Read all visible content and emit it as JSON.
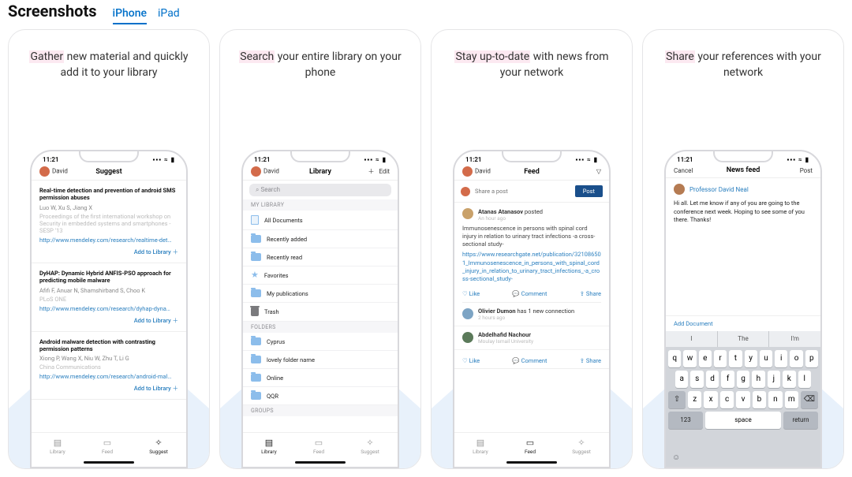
{
  "header": {
    "title": "Screenshots"
  },
  "tabs": [
    {
      "label": "iPhone",
      "active": true
    },
    {
      "label": "iPad",
      "active": false
    }
  ],
  "statusbar": {
    "time": "11:21",
    "right": "▪▪▪ ≈ ▮"
  },
  "captions": [
    {
      "hl": "Gather",
      "rest": " new material and quickly add it to your library"
    },
    {
      "hl": "Search",
      "rest": " your entire library on your phone"
    },
    {
      "hl": "Stay up-to-date",
      "rest": " with news from your network"
    },
    {
      "hl": "Share",
      "rest": " your references with your network"
    }
  ],
  "tabbar": [
    {
      "icon": "▤",
      "label": "Library"
    },
    {
      "icon": "▭",
      "label": "Feed"
    },
    {
      "icon": "✧",
      "label": "Suggest"
    }
  ],
  "card1": {
    "user": "David",
    "title": "Suggest",
    "items": [
      {
        "title": "Real-time detection and prevention of android SMS permission abuses",
        "authors": "Luo W, Xu S, Jiang X",
        "meta": "Proceedings of the first international workshop on Security in embedded systems and smartphones - SESP '13",
        "link": "http://www.mendeley.com/research/realtime-det…",
        "add": "Add to Library ＋"
      },
      {
        "title": "DyHAP: Dynamic Hybrid ANFIS-PSO approach for predicting mobile malware",
        "authors": "Afifi F, Anuar N, Shamshirband S, Choo K",
        "meta": "PLoS ONE",
        "link": "http://www.mendeley.com/research/dyhap-dyna…",
        "add": "Add to Library ＋"
      },
      {
        "title": "Android malware detection with contrasting permission patterns",
        "authors": "Xiong P, Wang X, Niu W, Zhu T, Li G",
        "meta": "China Communications",
        "link": "http://www.mendeley.com/research/android-mal…",
        "add": "Add to Library ＋"
      }
    ]
  },
  "card2": {
    "user": "David",
    "title": "Library",
    "add": "＋",
    "edit": "Edit",
    "search_placeholder": "⌕ Search",
    "sections": {
      "mylib": "MY LIBRARY",
      "folders": "FOLDERS",
      "groups": "GROUPS"
    },
    "mylib_items": [
      {
        "kind": "doc",
        "label": "All Documents"
      },
      {
        "kind": "folder",
        "label": "Recently added"
      },
      {
        "kind": "folder",
        "label": "Recently read"
      },
      {
        "kind": "star",
        "label": "Favorites"
      },
      {
        "kind": "folder",
        "label": "My publications"
      },
      {
        "kind": "trash",
        "label": "Trash"
      }
    ],
    "folders_items": [
      {
        "label": "Cyprus"
      },
      {
        "label": "lovely folder name"
      },
      {
        "label": "Online"
      },
      {
        "label": "QQR"
      }
    ]
  },
  "card3": {
    "user": "David",
    "title": "Feed",
    "share_placeholder": "Share a post",
    "post_btn": "Post",
    "feed": {
      "name": "Atanas Atanasov",
      "verb": "posted",
      "time": "An hour ago",
      "body": "Immunosenescence in persons with spinal cord injury in relation to urinary tract infections -a cross-sectional study-",
      "link": "https://www.researchgate.net/publication/321086501_Immunosenescence_in_persons_with_spinal_cord_injury_in_relation_to_urinary_tract_infections_-a_cross-sectional_study-"
    },
    "actions": {
      "like": "♡ Like",
      "comment": "💬 Comment",
      "share": "⇪ Share"
    },
    "sub1": {
      "name": "Olivier Dumon",
      "verb": "has 1 new connection",
      "time": "2 hours ago"
    },
    "sub2": {
      "name": "Abdelhafid Nachour",
      "meta": "Moulay Ismail University"
    }
  },
  "card4": {
    "cancel": "Cancel",
    "title": "News feed",
    "post": "Post",
    "author": "Professor David Neal",
    "message": "Hi all. Let me know if any of you are going to the conference next week. Hoping to see some of you there. Thanks!",
    "add_doc": "Add Document",
    "suggestions": [
      "I",
      "The",
      "I'm"
    ],
    "rows": {
      "r1": [
        "q",
        "w",
        "e",
        "r",
        "t",
        "y",
        "u",
        "i",
        "o",
        "p"
      ],
      "r2": [
        "a",
        "s",
        "d",
        "f",
        "g",
        "h",
        "j",
        "k",
        "l"
      ],
      "r3": [
        "⇧",
        "z",
        "x",
        "c",
        "v",
        "b",
        "n",
        "m",
        "⌫"
      ],
      "r4": {
        "num": "123",
        "space": "space",
        "ret": "return"
      }
    }
  }
}
